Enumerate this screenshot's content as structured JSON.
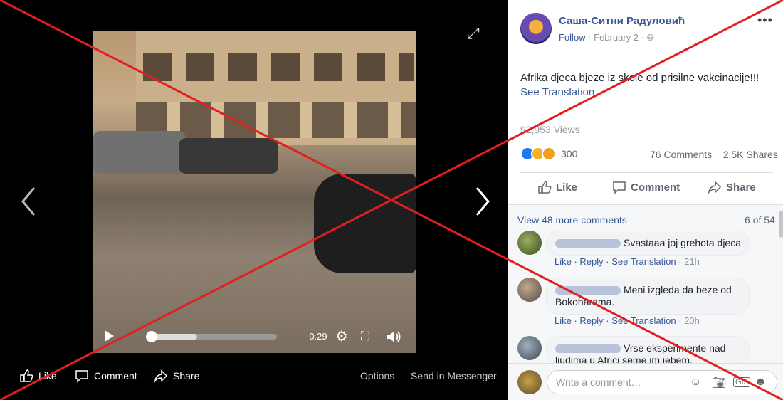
{
  "video": {
    "time_remaining": "-0:29",
    "progress": 0.39
  },
  "media_bar": {
    "like": "Like",
    "comment": "Comment",
    "share": "Share",
    "options": "Options",
    "send": "Send in Messenger"
  },
  "post": {
    "author": "Саша-Ситни Радуловић",
    "follow": "Follow",
    "date": "February 2",
    "text": "Afrika djeca bjeze iz skole od prisilne vakcinacije!!!",
    "see_translation": "See Translation",
    "views": "92,953 Views",
    "reaction_count": "300",
    "comments_count": "76 Comments",
    "shares_count": "2.5K Shares",
    "like_btn": "Like",
    "comment_btn": "Comment",
    "share_btn": "Share"
  },
  "comments": {
    "view_more": "View 48 more comments",
    "page": "6 of 54",
    "items": [
      {
        "text": "Svastaaa joj grehota djeca",
        "like": "Like",
        "reply": "Reply",
        "translate": "See Translation",
        "time": "21h"
      },
      {
        "text": "Meni izgleda da beze od Bokoharama.",
        "like": "Like",
        "reply": "Reply",
        "translate": "See Translation",
        "time": "20h"
      },
      {
        "text": "Vrse eksperimente nad ljudima u Africi seme im jebem."
      }
    ],
    "placeholder": "Write a comment…"
  },
  "colors": {
    "facebook_blue": "#385898",
    "cross_red": "#e02020"
  },
  "icons": [
    "expand-icon",
    "prev-arrow-icon",
    "next-arrow-icon",
    "play-icon",
    "settings-icon",
    "fullscreen-icon",
    "volume-icon",
    "thumbs-up-icon",
    "speech-bubble-icon",
    "share-arrow-icon",
    "globe-icon",
    "emoji-icon",
    "camera-icon",
    "gif-icon",
    "sticker-icon"
  ]
}
